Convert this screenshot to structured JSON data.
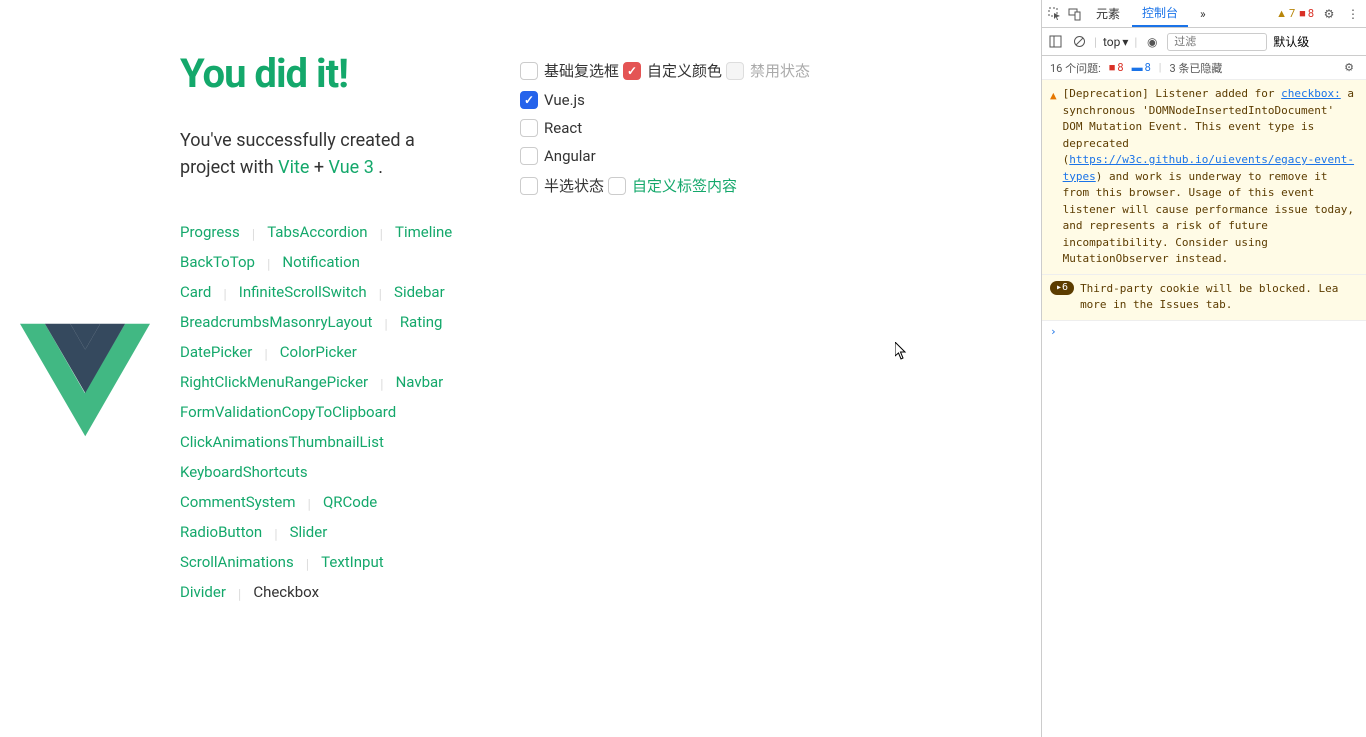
{
  "main": {
    "title": "You did it!",
    "subtitle_prefix": "You've successfully created a project with ",
    "vite": "Vite",
    "plus": " + ",
    "vue3": "Vue 3",
    "period": " ."
  },
  "nav": [
    [
      "Progress",
      "Tabs"
    ],
    [
      "Accordion",
      "Timeline"
    ],
    [
      "BackToTop",
      "Notification"
    ],
    [
      "Card",
      "InfiniteScroll"
    ],
    [
      "Switch",
      "Sidebar"
    ],
    [
      "Breadcrumbs"
    ],
    [
      "MasonryLayout",
      "Rating"
    ],
    [
      "DatePicker",
      "ColorPicker"
    ],
    [
      "RightClickMenu"
    ],
    [
      "RangePicker",
      "Navbar"
    ],
    [
      "FormValidation"
    ],
    [
      "CopyToClipboard"
    ],
    [
      "ClickAnimations"
    ],
    [
      "ThumbnailList"
    ],
    [
      "KeyboardShortcuts"
    ],
    [
      "CommentSystem",
      "QRCode"
    ],
    [
      "RadioButton",
      "Slider"
    ],
    [
      "ScrollAnimations",
      "TextInput"
    ],
    [
      "Divider",
      "Checkbox"
    ]
  ],
  "nav_current": "Checkbox",
  "checkboxes": {
    "basic": "基础复选框",
    "custom_color": "自定义颜色",
    "disabled": "禁用状态",
    "vuejs": "Vue.js",
    "react": "React",
    "angular": "Angular",
    "indeterminate": "半选状态",
    "custom_label": "自定义标签内容"
  },
  "devtools": {
    "tabs": {
      "elements": "元素",
      "console": "控制台"
    },
    "more": "»",
    "warn_count": "7",
    "err_count": "8",
    "top": "top",
    "filter_placeholder": "过滤",
    "default_level": "默认级",
    "issues_label": "16 个问题:",
    "issues_err": "8",
    "issues_info": "8",
    "issues_hidden": "3 条已隐藏",
    "msg1_prefix": "[Deprecation] Listener added for ",
    "msg1_link1": "checkbox:",
    "msg1_mid": " a synchronous 'DOMNodeInsertedIntoDocument' DOM Mutation Event. This event type is deprecated (",
    "msg1_link2": "https://w3c.github.io/uievents/",
    "msg1_link3": "egacy-event-types",
    "msg1_suffix": ") and work is underway to remove it from this browser. Usage of this event listener will cause performance issue today, and represents a risk of future incompatibility. Consider using MutationObserver instead.",
    "msg2_count": "6",
    "msg2_text": "Third-party cookie will be blocked. Lea more in the Issues tab."
  }
}
